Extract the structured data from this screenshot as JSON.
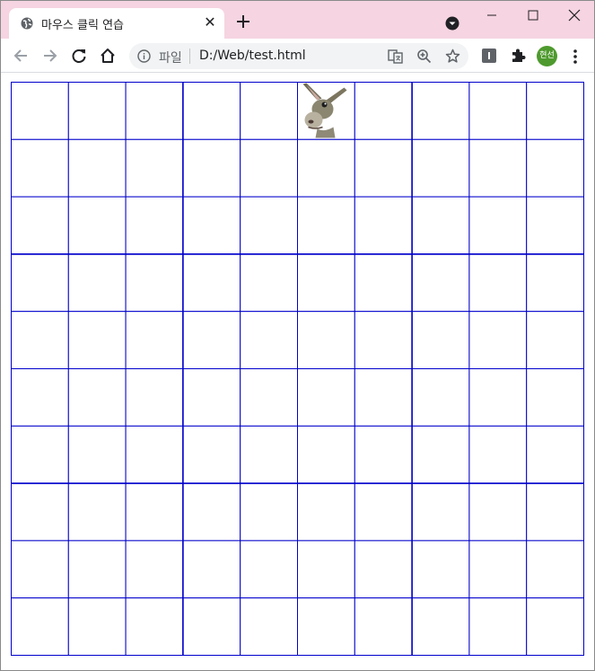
{
  "window": {
    "tab": {
      "title": "마우스 클릭 연습",
      "favicon": "globe-icon"
    },
    "controls": [
      "minimize-icon",
      "maximize-icon",
      "close-icon"
    ]
  },
  "toolbar": {
    "nav": [
      "back-arrow-icon",
      "forward-arrow-icon",
      "reload-icon",
      "home-icon"
    ],
    "omnibox": {
      "scheme_label": "파일",
      "url": "D:/Web/test.html"
    },
    "profile_initials": "현선"
  },
  "colors": {
    "titlebar": "#f6d4e1",
    "grid_line": "#0000cc",
    "avatar": "#4e9a2e"
  },
  "game": {
    "grid_rows": 10,
    "grid_cols": 10,
    "target": {
      "name": "donkey-target",
      "row": 0,
      "col": 5
    }
  }
}
